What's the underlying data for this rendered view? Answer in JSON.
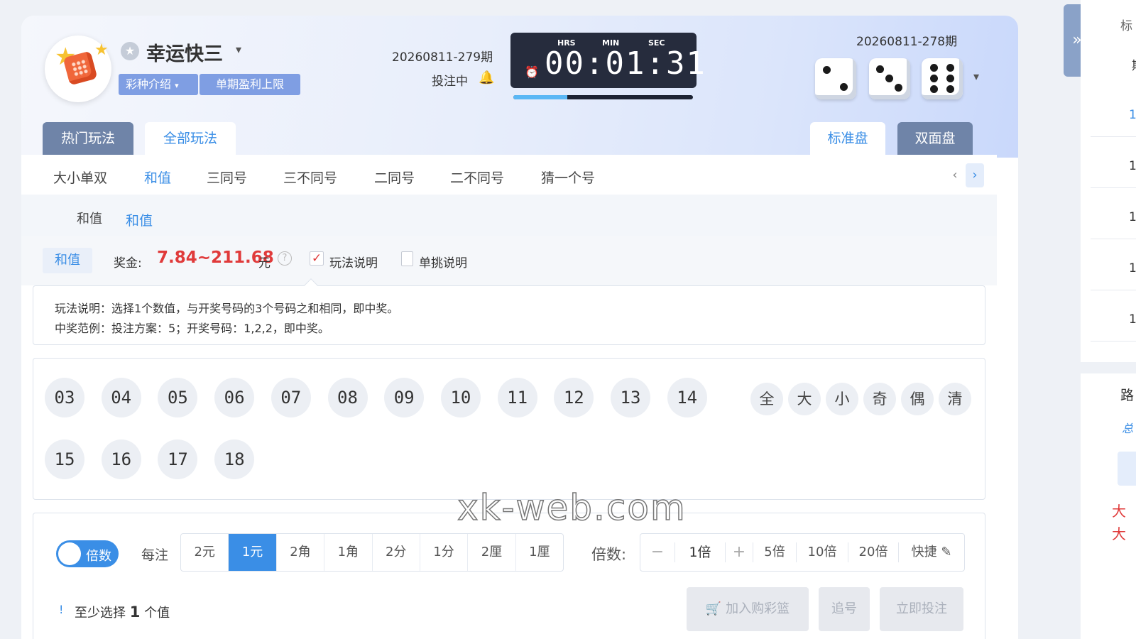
{
  "header": {
    "game_title": "幸运快三",
    "intro_label": "彩种介绍",
    "limit_label": "单期盈利上限",
    "current_period": "20260811-279期",
    "bet_status": "投注中",
    "timer_labels": {
      "hrs": "HRS",
      "min": "MIN",
      "sec": "SEC"
    },
    "countdown": "00:01:31",
    "countdown_progress": 0.3,
    "last_period": "20260811-278期",
    "last_dice": [
      2,
      3,
      6
    ]
  },
  "mode_tabs": [
    {
      "label": "热门玩法",
      "active": false
    },
    {
      "label": "全部玩法",
      "active": true
    }
  ],
  "plate_tabs": [
    {
      "label": "标准盘",
      "active": true
    },
    {
      "label": "双面盘",
      "active": false
    }
  ],
  "subnav": {
    "items": [
      "大小单双",
      "和值",
      "三同号",
      "三不同号",
      "二同号",
      "二不同号",
      "猜一个号"
    ],
    "active_index": 1,
    "prev_icon": "‹",
    "next_icon": "›"
  },
  "sub2": {
    "label": "和值",
    "item": "和值"
  },
  "info": {
    "play_tag": "和值",
    "prize_label": "奖金:",
    "prize_value": "7.84~211.68",
    "prize_unit": "元",
    "rules_label": "玩法说明",
    "single_label": "单挑说明"
  },
  "rules": {
    "line1": "玩法说明：选择1个数值，与开奖号码的3个号码之和相同，即中奖。",
    "line2": "中奖范例：投注方案：5；开奖号码：1,2,2，即中奖。"
  },
  "numbers": [
    "03",
    "04",
    "05",
    "06",
    "07",
    "08",
    "09",
    "10",
    "11",
    "12",
    "13",
    "14",
    "15",
    "16",
    "17",
    "18"
  ],
  "quick_select": [
    "全",
    "大",
    "小",
    "奇",
    "偶",
    "清"
  ],
  "bet": {
    "toggle_label": "倍数",
    "unit_label": "每注",
    "units": [
      "2元",
      "1元",
      "2角",
      "1角",
      "2分",
      "1分",
      "2厘",
      "1厘"
    ],
    "active_unit_index": 1,
    "multiplier_label": "倍数:",
    "multiplier_value": "1倍",
    "minus": "−",
    "plus": "+",
    "multiplier_presets": [
      "5倍",
      "10倍",
      "20倍"
    ],
    "shortcut_label": "快捷",
    "min_hint_icon": "!",
    "min_hint_prefix": "至少选择",
    "min_hint_count": "1",
    "min_hint_suffix": "个值",
    "add_cart": "加入购彩篮",
    "chase": "追号",
    "bet_now": "立即投注"
  },
  "watermark": "xk-web.com",
  "right_panel": {
    "collapse_icon": "»",
    "header_fragment": "标",
    "row_fragment": "期",
    "trend_fragment": "路",
    "total_fragment": "总",
    "row_marks": [
      "1",
      "1",
      "1",
      "1",
      "1"
    ],
    "big_marks": [
      "大",
      "大"
    ]
  },
  "colors": {
    "accent": "#3a8ee6",
    "prize": "#e03a3a",
    "timer_bg": "#262c3d",
    "tag_bg": "#7f9ee3"
  }
}
